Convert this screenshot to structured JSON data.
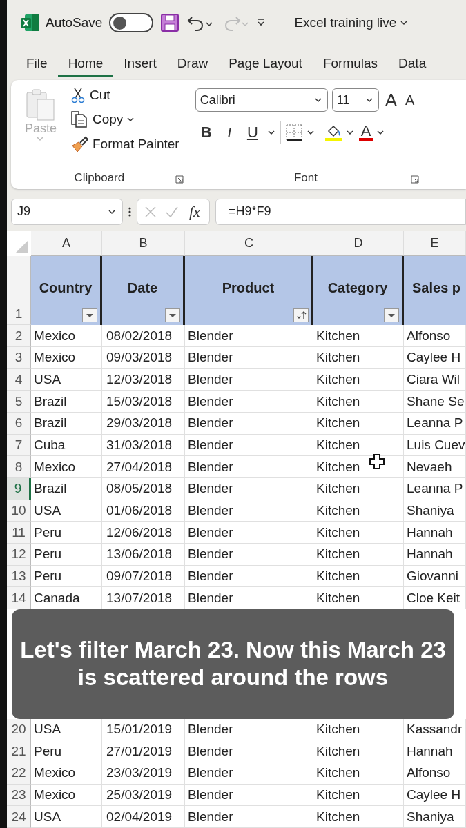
{
  "title_bar": {
    "autosave_label": "AutoSave",
    "autosave_on": false,
    "redo_disabled": true,
    "file_name": "Excel training live"
  },
  "menu_tabs": [
    {
      "label": "File",
      "selected": false
    },
    {
      "label": "Home",
      "selected": true
    },
    {
      "label": "Insert",
      "selected": false
    },
    {
      "label": "Draw",
      "selected": false
    },
    {
      "label": "Page Layout",
      "selected": false
    },
    {
      "label": "Formulas",
      "selected": false
    },
    {
      "label": "Data",
      "selected": false
    }
  ],
  "ribbon": {
    "clipboard": {
      "paste": {
        "label": "Paste",
        "disabled": true
      },
      "cut": "Cut",
      "copy": "Copy",
      "format_painter": "Format Painter",
      "group_label": "Clipboard"
    },
    "font": {
      "font_name": "Calibri",
      "font_size": "11",
      "grow": "A",
      "shrink": "A",
      "bold": "B",
      "italic": "I",
      "underline": "U",
      "font_color": "A",
      "group_label": "Font"
    }
  },
  "formula_bar": {
    "name_box": "J9",
    "fx": "fx",
    "formula": "=H9*F9"
  },
  "columns": [
    {
      "letter": "A",
      "header": "Country",
      "kind": "filter"
    },
    {
      "letter": "B",
      "header": "Date",
      "kind": "filter"
    },
    {
      "letter": "C",
      "header": "Product",
      "kind": "sorted"
    },
    {
      "letter": "D",
      "header": "Category",
      "kind": "filter"
    },
    {
      "letter": "E",
      "header": "Sales p",
      "kind": "plain"
    }
  ],
  "header_row": "1",
  "rows_above": [
    {
      "num": "2",
      "selected": false,
      "cells": [
        "Mexico",
        "08/02/2018",
        "Blender",
        "Kitchen",
        "Alfonso"
      ]
    },
    {
      "num": "3",
      "selected": false,
      "cells": [
        "Mexico",
        "09/03/2018",
        "Blender",
        "Kitchen",
        "Caylee H"
      ]
    },
    {
      "num": "4",
      "selected": false,
      "cells": [
        "USA",
        "12/03/2018",
        "Blender",
        "Kitchen",
        "Ciara Wil"
      ]
    },
    {
      "num": "5",
      "selected": false,
      "cells": [
        "Brazil",
        "15/03/2018",
        "Blender",
        "Kitchen",
        "Shane Se"
      ]
    },
    {
      "num": "6",
      "selected": false,
      "cells": [
        "Brazil",
        "29/03/2018",
        "Blender",
        "Kitchen",
        "Leanna P"
      ]
    },
    {
      "num": "7",
      "selected": false,
      "cells": [
        "Cuba",
        "31/03/2018",
        "Blender",
        "Kitchen",
        "Luis Cuev"
      ]
    },
    {
      "num": "8",
      "selected": false,
      "cells": [
        "Mexico",
        "27/04/2018",
        "Blender",
        "Kitchen",
        "Nevaeh"
      ]
    },
    {
      "num": "9",
      "selected": true,
      "cells": [
        "Brazil",
        "08/05/2018",
        "Blender",
        "Kitchen",
        "Leanna P"
      ]
    },
    {
      "num": "10",
      "selected": false,
      "cells": [
        "USA",
        "01/06/2018",
        "Blender",
        "Kitchen",
        "Shaniya"
      ]
    },
    {
      "num": "11",
      "selected": false,
      "cells": [
        "Peru",
        "12/06/2018",
        "Blender",
        "Kitchen",
        "Hannah"
      ]
    },
    {
      "num": "12",
      "selected": false,
      "cells": [
        "Peru",
        "13/06/2018",
        "Blender",
        "Kitchen",
        "Hannah"
      ]
    },
    {
      "num": "13",
      "selected": false,
      "cells": [
        "Peru",
        "09/07/2018",
        "Blender",
        "Kitchen",
        "Giovanni"
      ]
    },
    {
      "num": "14",
      "selected": false,
      "cells": [
        "Canada",
        "13/07/2018",
        "Blender",
        "Kitchen",
        "Cloe Keit"
      ]
    }
  ],
  "caption": "Let's filter March 23. Now this March 23 is scattered around the rows",
  "rows_below": [
    {
      "num": "20",
      "selected": false,
      "cells": [
        "USA",
        "15/01/2019",
        "Blender",
        "Kitchen",
        "Kassandr"
      ]
    },
    {
      "num": "21",
      "selected": false,
      "cells": [
        "Peru",
        "27/01/2019",
        "Blender",
        "Kitchen",
        "Hannah"
      ]
    },
    {
      "num": "22",
      "selected": false,
      "cells": [
        "Mexico",
        "23/03/2019",
        "Blender",
        "Kitchen",
        "Alfonso"
      ]
    },
    {
      "num": "23",
      "selected": false,
      "cells": [
        "Mexico",
        "25/03/2019",
        "Blender",
        "Kitchen",
        "Caylee H"
      ]
    },
    {
      "num": "24",
      "selected": false,
      "cells": [
        "USA",
        "02/04/2019",
        "Blender",
        "Kitchen",
        "Shaniya"
      ]
    }
  ]
}
